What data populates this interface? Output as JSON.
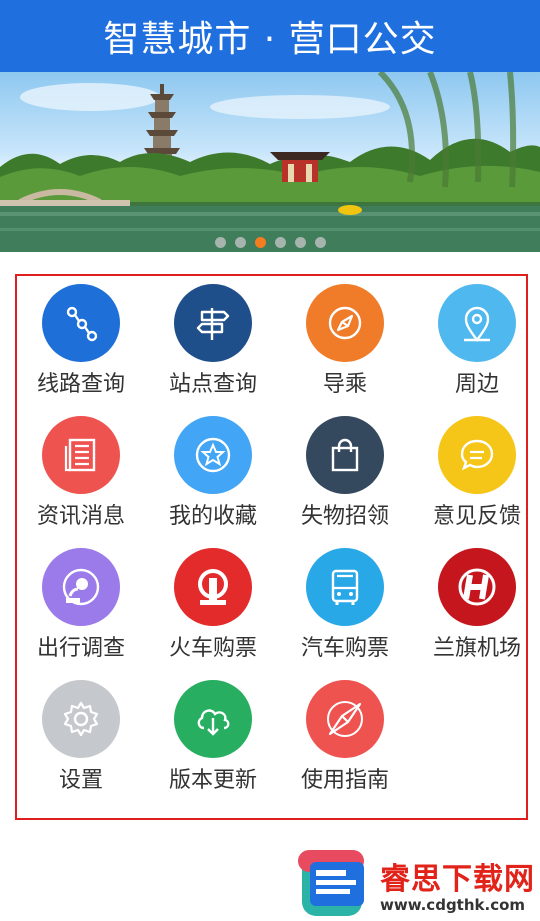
{
  "header": {
    "title": "智慧城市 · 营口公交"
  },
  "banner": {
    "slide_count": 6,
    "active_index": 2
  },
  "menu": {
    "items": [
      {
        "label": "线路查询",
        "icon": "route-icon",
        "color": "#1f6fd8"
      },
      {
        "label": "站点查询",
        "icon": "signpost-icon",
        "color": "#1f4f8a"
      },
      {
        "label": "导乘",
        "icon": "compass-icon",
        "color": "#f07c2a"
      },
      {
        "label": "周边",
        "icon": "location-pin-icon",
        "color": "#4fb8ef"
      },
      {
        "label": "资讯消息",
        "icon": "newspaper-icon",
        "color": "#ef5350"
      },
      {
        "label": "我的收藏",
        "icon": "star-icon",
        "color": "#42a5f5"
      },
      {
        "label": "失物招领",
        "icon": "shopping-bag-icon",
        "color": "#34495e"
      },
      {
        "label": "意见反馈",
        "icon": "chat-bubble-icon",
        "color": "#f5c518"
      },
      {
        "label": "出行调查",
        "icon": "survey-person-icon",
        "color": "#9b7bea"
      },
      {
        "label": "火车购票",
        "icon": "railway-logo-icon",
        "color": "#e32b2b"
      },
      {
        "label": "汽车购票",
        "icon": "bus-icon",
        "color": "#29a8e8"
      },
      {
        "label": "兰旗机场",
        "icon": "airport-logo-icon",
        "color": "#c4161c"
      },
      {
        "label": "设置",
        "icon": "gear-icon",
        "color": "#c5c8cc"
      },
      {
        "label": "版本更新",
        "icon": "cloud-download-icon",
        "color": "#27ae60"
      },
      {
        "label": "使用指南",
        "icon": "guide-compass-icon",
        "color": "#ef5350"
      }
    ]
  },
  "watermark": {
    "name": "睿思下载网",
    "url": "www.cdgthk.com"
  }
}
